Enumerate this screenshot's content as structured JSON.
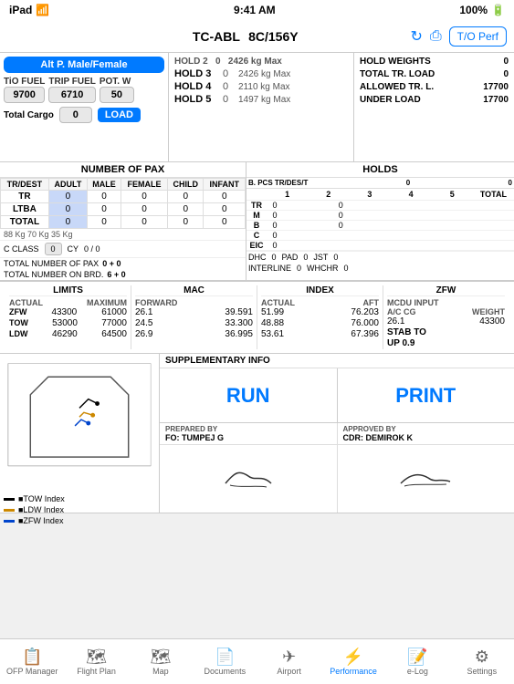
{
  "statusBar": {
    "left": "iPad",
    "time": "9:41 AM",
    "battery": "100%"
  },
  "topBar": {
    "aircraft": "TC-ABL",
    "config": "8C/156Y",
    "toperf": "T/O Perf"
  },
  "fuel": {
    "tioFuelLabel": "TiO FUEL",
    "tioFuelValue": "9700",
    "tripFuelLabel": "TRIP FUEL",
    "tripFuelValue": "6710",
    "potWLabel": "POT. W",
    "potWValue": "50",
    "totalCargoLabel": "Total Cargo",
    "totalCargoValue": "0",
    "loadLabel": "LOAD",
    "paxBtnLabel": "Alt P. Male/Female"
  },
  "holds": {
    "title": "HOLD 2",
    "hold2Label": "HOLD 2",
    "hold2Val": "0",
    "hold2Max": "2426 kg Max",
    "hold3Label": "HOLD 3",
    "hold3Val": "0",
    "hold3Max": "2426 kg Max",
    "hold4Label": "HOLD 4",
    "hold4Val": "0",
    "hold4Max": "2110 kg Max",
    "hold5Label": "HOLD 5",
    "hold5Val": "0",
    "hold5Max": "1497 kg Max",
    "topText": "kg Max"
  },
  "holdWeights": {
    "holdWeightsLabel": "HOLD WEIGHTS",
    "holdWeightsVal": "0",
    "totalTrLoadLabel": "TOTAL TR. LOAD",
    "totalTrLoadVal": "0",
    "allowedTrLLabel": "ALLOWED TR. L.",
    "allowedTrLVal": "17700",
    "underLoadLabel": "UNDER LOAD",
    "underLoadVal": "17700"
  },
  "pax": {
    "sectionTitle": "NUMBER OF PAX",
    "headers": [
      "TR/DEST",
      "ADULT",
      "MALE",
      "FEMALE",
      "CHILD",
      "INFANT"
    ],
    "rows": [
      {
        "label": "TR",
        "adult": "0",
        "male": "0",
        "female": "0",
        "child": "0",
        "infant": "0"
      },
      {
        "label": "LTBA",
        "adult": "0",
        "male": "0",
        "female": "0",
        "child": "0",
        "infant": "0"
      },
      {
        "label": "TOTAL",
        "adult": "0",
        "male": "0",
        "female": "0",
        "child": "0",
        "infant": "0"
      }
    ],
    "weights": "88 Kg    70 Kg    35 Kg",
    "cclassLabel": "C CLASS",
    "cclassVal": "0",
    "cyLabel": "CY",
    "cyVal": "0 / 0",
    "totalPaxLabel": "TOTAL NUMBER OF PAX",
    "totalPaxVal": "0 + 0",
    "totalBrdLabel": "TOTAL NUMBER ON BRD.",
    "totalBrdVal": "6 + 0"
  },
  "holdsTable": {
    "sectionTitle": "HOLDS",
    "bPcsLabel": "B. PCS TR/DES/T",
    "col0": "0",
    "col1": "0",
    "numHeaders": [
      "1",
      "2",
      "3",
      "4",
      "5",
      "TOTAL"
    ],
    "rows": [
      {
        "label": "TR",
        "val0": "0",
        "vals": [
          "",
          "0",
          "",
          "",
          "",
          ""
        ]
      },
      {
        "label": "M",
        "val0": "0",
        "vals": [
          "",
          "0",
          "",
          "",
          "",
          ""
        ]
      },
      {
        "label": "B",
        "val0": "0",
        "vals": [
          "",
          "0",
          "",
          "",
          "",
          ""
        ]
      },
      {
        "label": "C",
        "val0": "0",
        "vals": [
          "",
          "",
          "",
          "",
          "",
          ""
        ]
      },
      {
        "label": "EIC",
        "val0": "0",
        "vals": [
          "",
          "",
          "",
          "",
          "",
          ""
        ]
      }
    ],
    "dhcLabel": "DHC",
    "dhcVal": "0",
    "padLabel": "PAD",
    "padVal": "0",
    "jstLabel": "JST",
    "jstVal": "0",
    "interlineLabel": "INTERLINE",
    "interlineVal": "0",
    "whchrLabel": "WHCHR",
    "whchrVal": "0"
  },
  "limits": {
    "title": "LIMITS",
    "actualLabel": "ACTUAL",
    "maximumLabel": "MAXIMUM",
    "zfwLabel": "ZFW",
    "zfwActual": "43300",
    "zfwMax": "61000",
    "towLabel": "TOW",
    "towActual": "53000",
    "towMax": "77000",
    "ldwLabel": "LDW",
    "ldwActual": "46290",
    "ldwMax": "64500"
  },
  "mac": {
    "title": "MAC",
    "forwardLabel": "FORWARD",
    "zfwMac": "26.1",
    "zfwFwd": "39.591",
    "towMac": "24.5",
    "towFwd": "33.300",
    "ldwMac": "26.9",
    "ldwFwd": "36.995"
  },
  "index": {
    "title": "INDEX",
    "actualLabel": "ACTUAL",
    "aftLabel": "AFT",
    "zfwActual": "51.99",
    "zfwAft": "76.203",
    "towActual": "48.88",
    "towAft": "76.000",
    "ldwActual": "53.61",
    "ldwAft": "67.396"
  },
  "zfw": {
    "title": "ZFW",
    "mcduInputLabel": "MCDU INPUT",
    "acCgLabel": "A/C CG",
    "weightLabel": "WEIGHT",
    "acCgVal": "26.1",
    "weightVal": "43300",
    "stabToLabel": "STAB TO",
    "stabToVal": "UP 0.9"
  },
  "actions": {
    "runLabel": "RUN",
    "printLabel": "PRINT",
    "preparedByLabel": "PREPARED BY",
    "preparedByVal": "FO: TUMPEJ G",
    "approvedByLabel": "APPROVED BY",
    "approvedByVal": "CDR: DEMIROK K",
    "suppInfoLabel": "SUPPLEMENTARY INFO"
  },
  "envelope": {
    "legend": [
      {
        "label": "TOW Index",
        "color": "#000000"
      },
      {
        "label": "LDW Index",
        "color": "#cc8800"
      },
      {
        "label": "ZFW Index",
        "color": "#0044cc"
      }
    ]
  },
  "nav": {
    "items": [
      {
        "label": "OFP Manager",
        "icon": "📋"
      },
      {
        "label": "Flight Plan",
        "icon": "🗺"
      },
      {
        "label": "Map",
        "icon": "🗺"
      },
      {
        "label": "Documents",
        "icon": "📄"
      },
      {
        "label": "Airport",
        "icon": "✈"
      },
      {
        "label": "Performance",
        "icon": "⚡",
        "active": true
      },
      {
        "label": "e-Log",
        "icon": "📝"
      },
      {
        "label": "Settings",
        "icon": "⚙"
      }
    ]
  }
}
